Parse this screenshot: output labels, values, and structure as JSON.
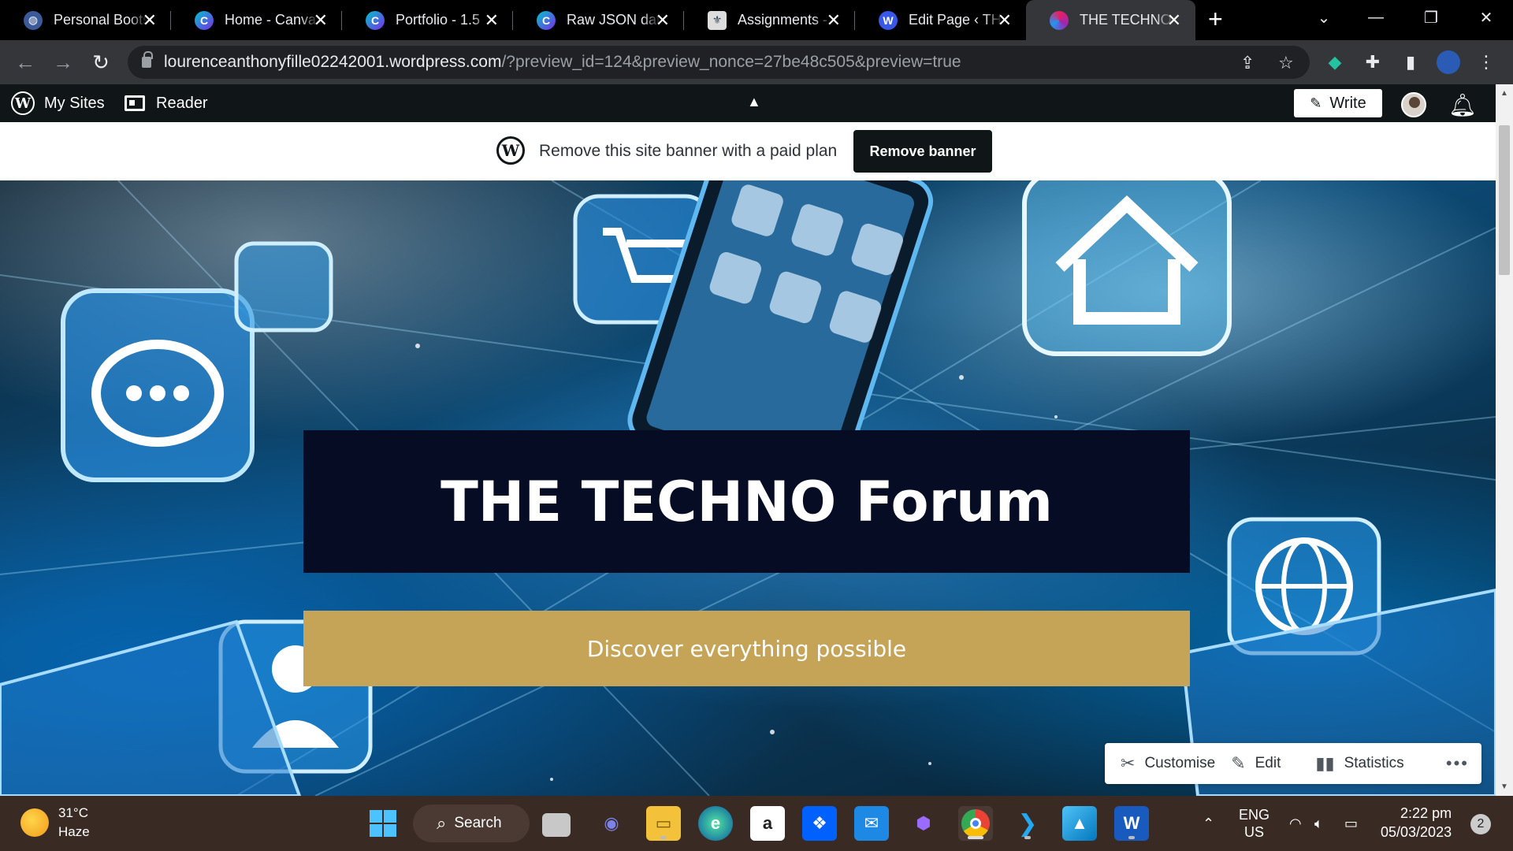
{
  "browser": {
    "tabs": [
      {
        "title": "Personal Boots",
        "icon": "globe-icon"
      },
      {
        "title": "Home - Canva",
        "icon": "canva-icon"
      },
      {
        "title": "Portfolio - 1.5",
        "icon": "canva-icon"
      },
      {
        "title": "Raw JSON data",
        "icon": "canva-icon"
      },
      {
        "title": "Assignments -",
        "icon": "school-icon"
      },
      {
        "title": "Edit Page ‹ THE",
        "icon": "wordpress-icon"
      },
      {
        "title": "THE TECHNO F",
        "icon": "site-icon"
      }
    ],
    "active_tab": 6,
    "url_host": "lourenceanthonyfille02242001.wordpress.com",
    "url_path": "/?preview_id=124&preview_nonce=27be48c505&preview=true"
  },
  "adminbar": {
    "my_sites": "My Sites",
    "reader": "Reader",
    "write": "Write"
  },
  "banner": {
    "text": "Remove this site banner with a paid plan",
    "button": "Remove banner"
  },
  "hero": {
    "title": "THE TECHNO Forum",
    "tagline": "Discover everything possible"
  },
  "actionbar": {
    "customise": "Customise",
    "edit": "Edit",
    "statistics": "Statistics"
  },
  "taskbar": {
    "temperature": "31°C",
    "condition": "Haze",
    "search": "Search",
    "lang_top": "ENG",
    "lang_bottom": "US",
    "time": "2:22 pm",
    "date": "05/03/2023",
    "notification_count": "2"
  },
  "colors": {
    "title_bg": "#050c24",
    "tagline_bg": "#c6a457",
    "adminbar_bg": "#101517",
    "taskbar_bg": "#3a2a24"
  }
}
